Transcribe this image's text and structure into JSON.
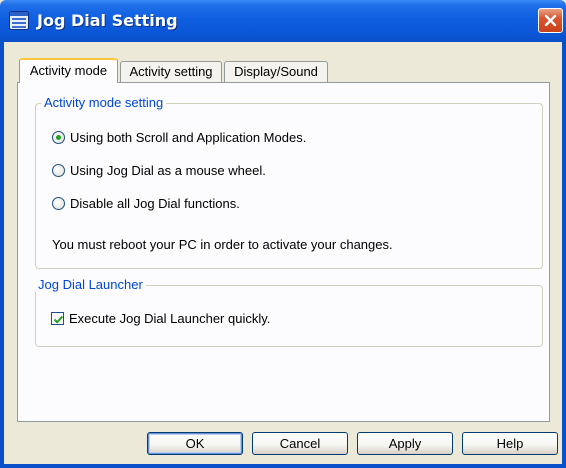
{
  "window": {
    "title": "Jog Dial Setting"
  },
  "tabs": [
    {
      "label": "Activity mode",
      "active": true
    },
    {
      "label": "Activity setting",
      "active": false
    },
    {
      "label": "Display/Sound",
      "active": false
    }
  ],
  "activity_mode_group": {
    "legend": "Activity mode setting",
    "options": [
      {
        "label": "Using both Scroll and Application Modes.",
        "selected": true
      },
      {
        "label": "Using Jog Dial as a mouse wheel.",
        "selected": false
      },
      {
        "label": "Disable all Jog Dial functions.",
        "selected": false
      }
    ],
    "note": "You must reboot your PC in order to activate your changes."
  },
  "launcher_group": {
    "legend": "Jog Dial Launcher",
    "checkbox": {
      "label": "Execute Jog Dial Launcher quickly.",
      "checked": true
    }
  },
  "buttons": {
    "ok": "OK",
    "cancel": "Cancel",
    "apply": "Apply",
    "help": "Help"
  },
  "colors": {
    "titlebar": "#0b56d6",
    "accent_tab": "#ffc83c",
    "group_legend": "#0046d5",
    "radio_dot": "#21a121"
  }
}
